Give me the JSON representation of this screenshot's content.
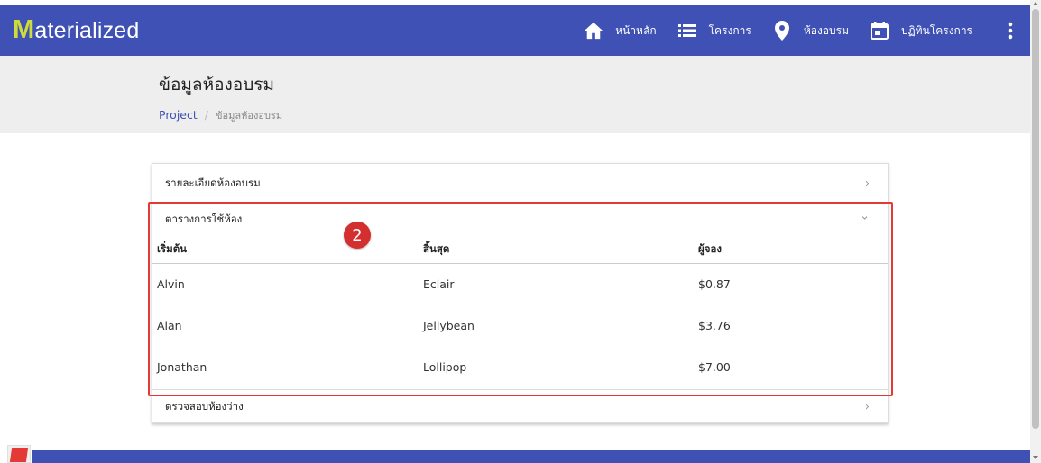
{
  "brand": {
    "first": "M",
    "rest": "aterialized"
  },
  "nav": {
    "items": [
      {
        "id": "home",
        "label": "หน้าหลัก",
        "icon": "home-icon"
      },
      {
        "id": "projects",
        "label": "โครงการ",
        "icon": "list-icon"
      },
      {
        "id": "rooms",
        "label": "ห้องอบรม",
        "icon": "location-pin-icon"
      },
      {
        "id": "calendar",
        "label": "ปฏิทินโครงการ",
        "icon": "calendar-icon"
      }
    ],
    "more_icon": "more-vert-icon"
  },
  "page": {
    "title": "ข้อมูลห้องอบรม",
    "breadcrumb": {
      "link": "Project",
      "separator": "/",
      "current": "ข้อมูลห้องอบรม"
    }
  },
  "sections": [
    {
      "label": "รายละเอียดห้องอบรม",
      "chevron": "›"
    },
    {
      "label": "ตารางการใช้ห้อง",
      "chevron": "⌄"
    },
    {
      "label": "ตรวจสอบห้องว่าง",
      "chevron": "›"
    }
  ],
  "table": {
    "headers": [
      "เริ่มต้น",
      "สิ้นสุด",
      "ผู้จอง"
    ],
    "rows": [
      [
        "Alvin",
        "Eclair",
        "$0.87"
      ],
      [
        "Alan",
        "Jellybean",
        "$3.76"
      ],
      [
        "Jonathan",
        "Lollipop",
        "$7.00"
      ]
    ]
  },
  "annotation": {
    "step": "2"
  },
  "colors": {
    "primary": "#3f51b5",
    "brand_accent": "#cddc39",
    "highlight": "#e53935"
  }
}
